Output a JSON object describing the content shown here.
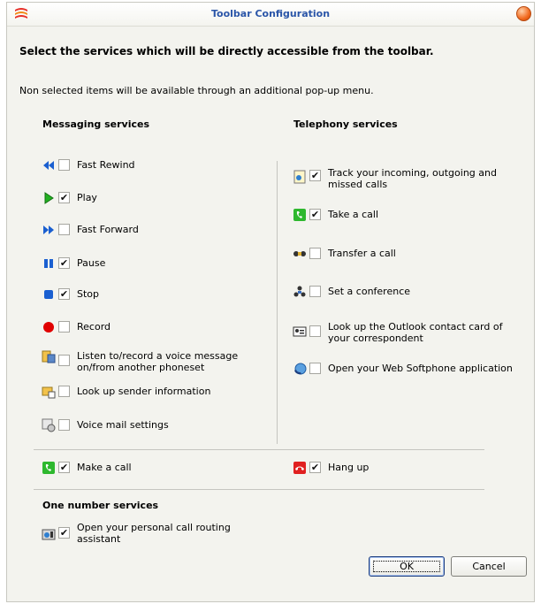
{
  "window": {
    "title": "Toolbar Configuration"
  },
  "header": {
    "instruction": "Select the services which will be directly accessible from the toolbar.",
    "note": "Non selected items will be available through an additional pop-up menu."
  },
  "messaging": {
    "heading": "Messaging services",
    "items": [
      {
        "label": "Fast Rewind",
        "checked": false,
        "icon": "fast-rewind-icon"
      },
      {
        "label": "Play",
        "checked": true,
        "icon": "play-icon"
      },
      {
        "label": "Fast Forward",
        "checked": false,
        "icon": "fast-forward-icon"
      },
      {
        "label": "Pause",
        "checked": true,
        "icon": "pause-icon"
      },
      {
        "label": "Stop",
        "checked": true,
        "icon": "stop-icon"
      },
      {
        "label": "Record",
        "checked": false,
        "icon": "record-icon"
      },
      {
        "label": "Listen to/record a voice message on/from another phoneset",
        "checked": false,
        "icon": "voice-message-icon"
      },
      {
        "label": "Look up sender information",
        "checked": false,
        "icon": "sender-info-icon"
      },
      {
        "label": "Voice mail settings",
        "checked": false,
        "icon": "voicemail-settings-icon"
      }
    ]
  },
  "telephony": {
    "heading": "Telephony services",
    "items": [
      {
        "label": "Track your incoming, outgoing and missed calls",
        "checked": true,
        "icon": "call-log-icon"
      },
      {
        "label": "Take a call",
        "checked": true,
        "icon": "take-call-icon"
      },
      {
        "label": "Transfer a call",
        "checked": false,
        "icon": "transfer-call-icon"
      },
      {
        "label": "Set a conference",
        "checked": false,
        "icon": "conference-icon"
      },
      {
        "label": "Look up the Outlook contact card of your correspondent",
        "checked": false,
        "icon": "contact-card-icon"
      },
      {
        "label": "Open your Web Softphone application",
        "checked": false,
        "icon": "web-softphone-icon"
      }
    ]
  },
  "calls": {
    "make_call": {
      "label": "Make a call",
      "checked": true,
      "icon": "make-call-icon"
    },
    "hang_up": {
      "label": "Hang up",
      "checked": true,
      "icon": "hang-up-icon"
    }
  },
  "one_number": {
    "heading": "One number services",
    "item": {
      "label": "Open your personal call routing assistant",
      "checked": true,
      "icon": "call-routing-icon"
    }
  },
  "buttons": {
    "ok": "OK",
    "cancel": "Cancel"
  },
  "check_glyph": "✔",
  "colors": {
    "title": "#2a55a8",
    "media_blue": "#1a5fd0",
    "media_green": "#22b022",
    "record_red": "#e00000",
    "hang_up_red": "#e02020",
    "call_green": "#2eb82e"
  }
}
